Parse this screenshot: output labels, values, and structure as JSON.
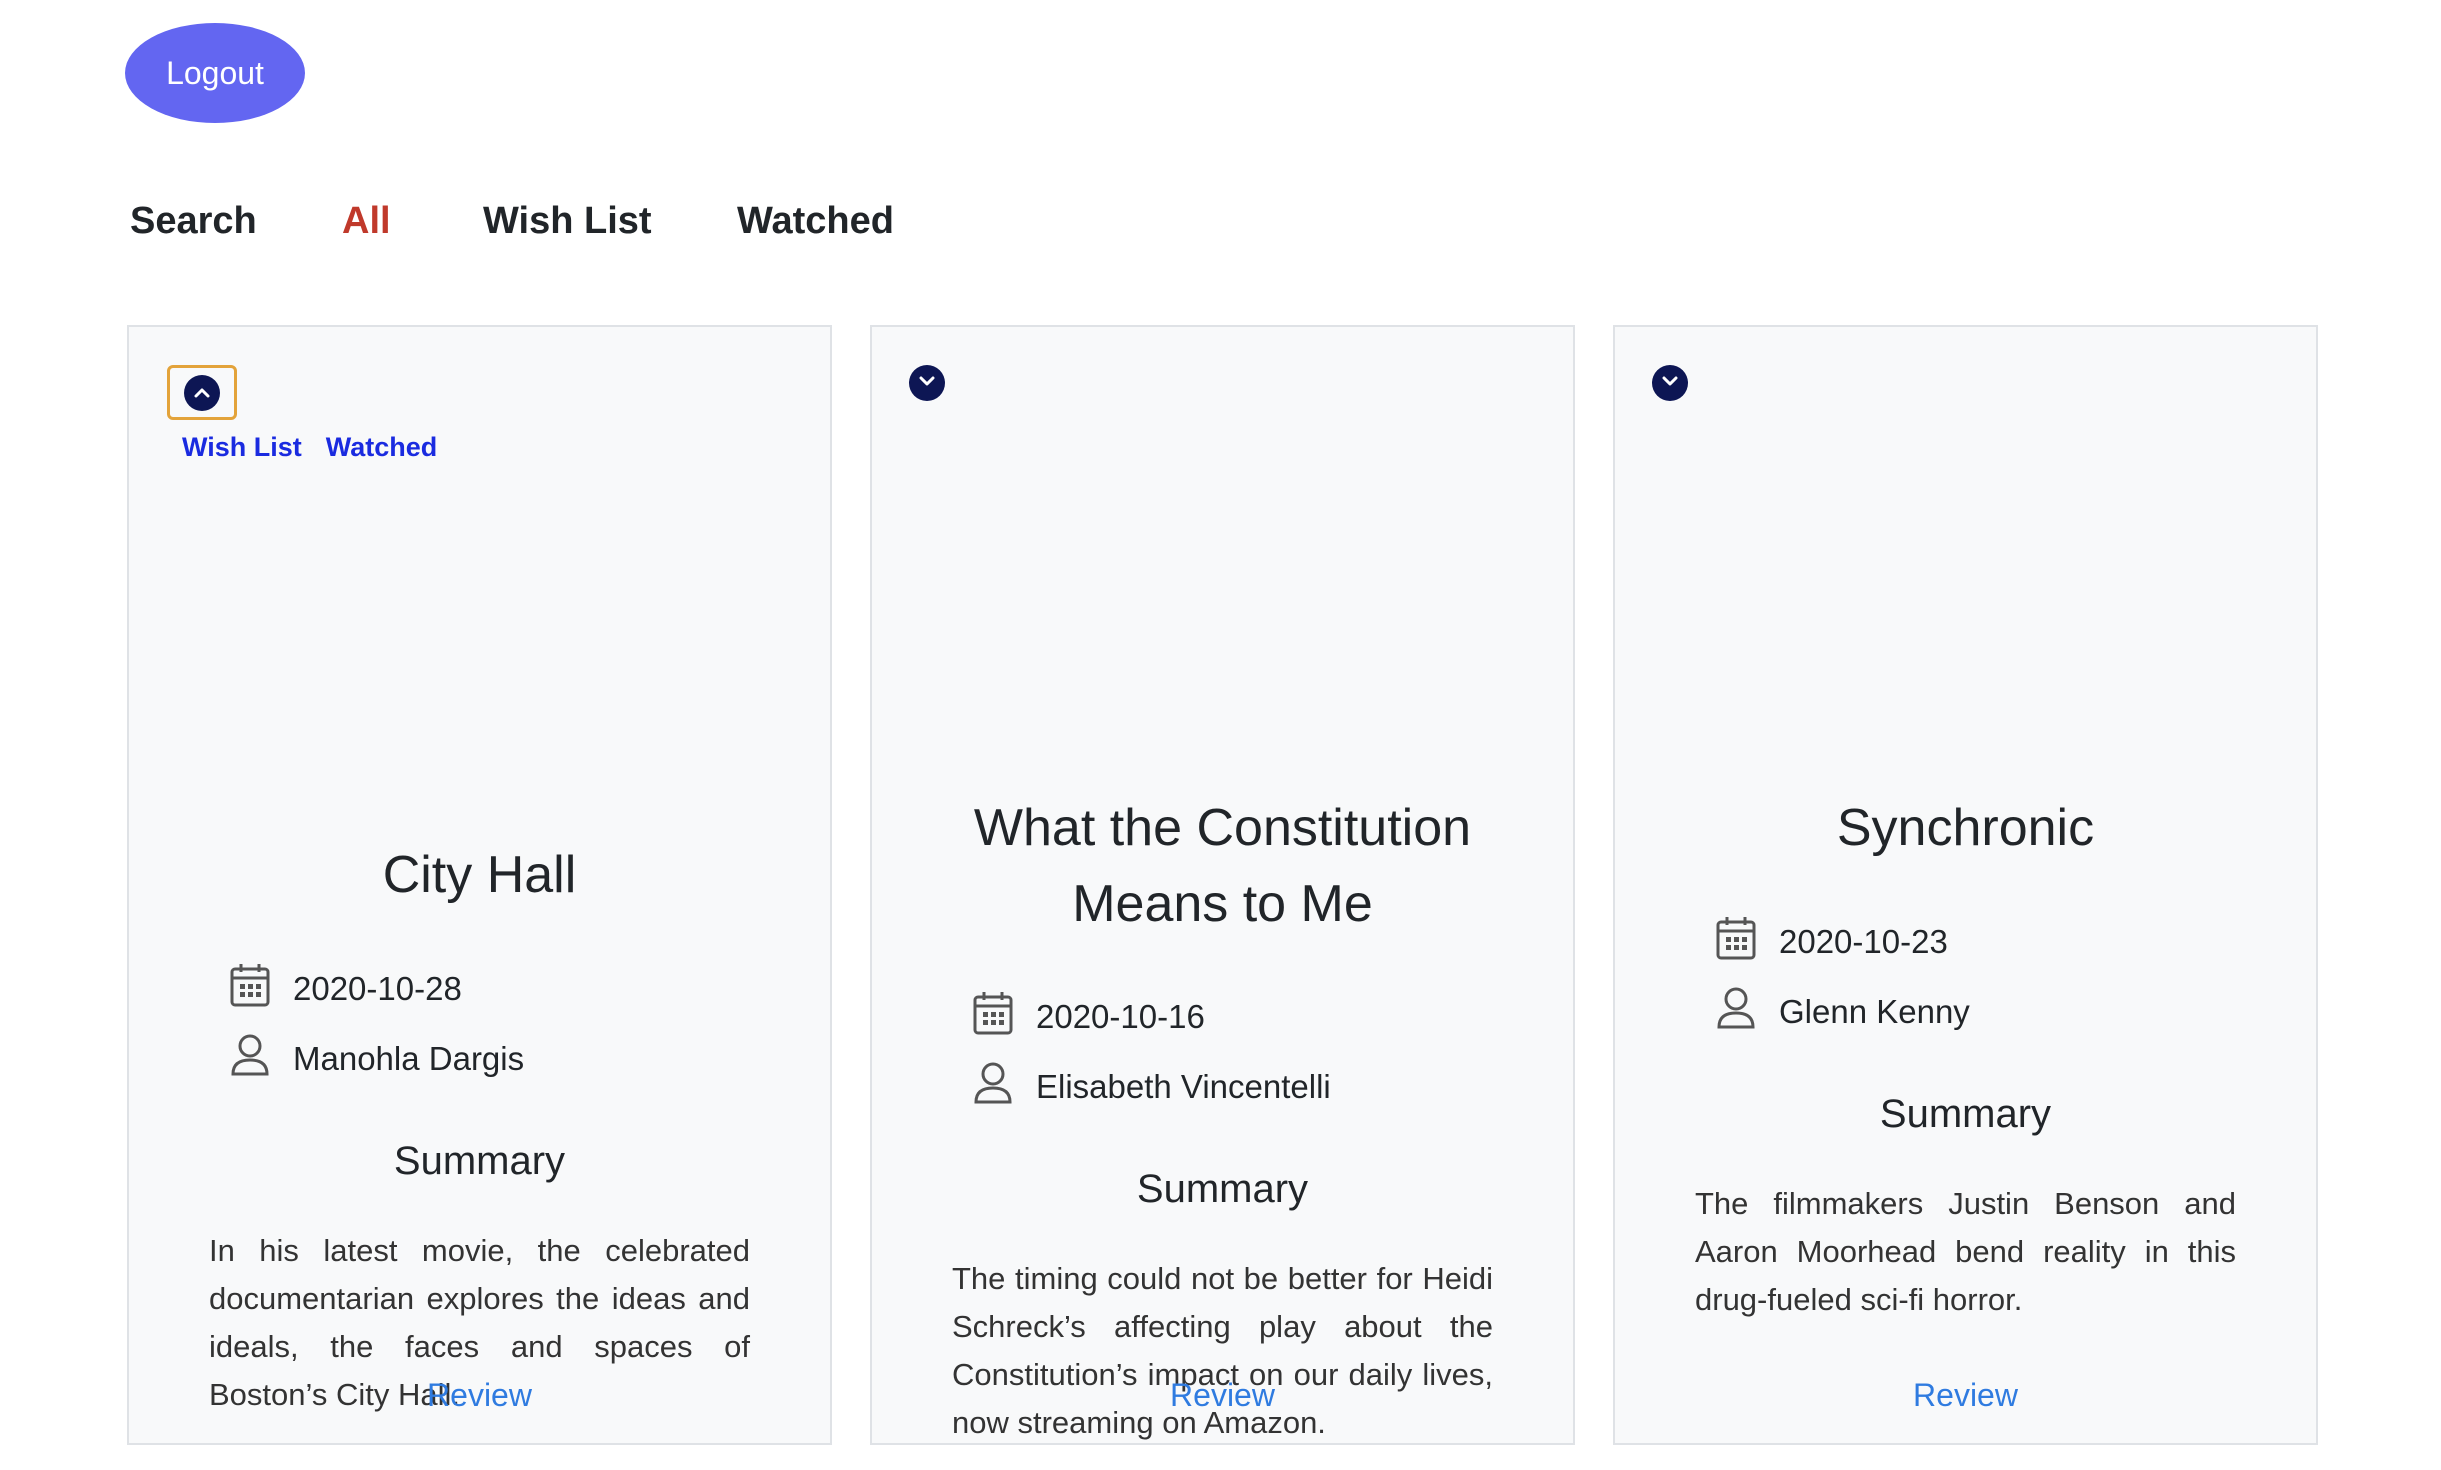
{
  "header": {
    "logout_label": "Logout"
  },
  "nav": {
    "items": [
      {
        "label": "Search"
      },
      {
        "label": "All"
      },
      {
        "label": "Wish List"
      },
      {
        "label": "Watched"
      }
    ],
    "active": "All"
  },
  "cards": [
    {
      "title_lines": [
        "City Hall"
      ],
      "date": "2020-10-28",
      "author": "Manohla Dargis",
      "summary_heading": "Summary",
      "summary": "In his latest movie, the celebrated documentarian explores the ideas and ideals, the faces and spaces of Boston’s City Hall.",
      "review_label": "Review",
      "expanded": true,
      "menu": {
        "wishlist": "Wish List",
        "watched": "Watched"
      }
    },
    {
      "title_lines": [
        "What the Constitution",
        "Means to Me"
      ],
      "date": "2020-10-16",
      "author": "Elisabeth Vincentelli",
      "summary_heading": "Summary",
      "summary": "The timing could not be better for Heidi Schreck’s affecting play about the Constitution’s impact on our daily lives, now streaming on Amazon.",
      "review_label": "Review",
      "expanded": false
    },
    {
      "title_lines": [
        "Synchronic"
      ],
      "date": "2020-10-23",
      "author": "Glenn Kenny",
      "summary_heading": "Summary",
      "summary": "The filmmakers Justin Benson and Aaron Moorhead bend reality in this drug-fueled sci-fi horror.",
      "review_label": "Review",
      "expanded": false
    }
  ],
  "colors": {
    "logout_bg": "#6366f1",
    "active_tab": "#c0392b",
    "link_blue": "#1a2be0",
    "review_blue": "#2f7be0",
    "toggle_navy": "#0d1654",
    "focus_ring": "#e3a33a"
  },
  "icons": [
    "chevron-up-icon",
    "chevron-down-icon",
    "calendar-icon",
    "person-icon"
  ]
}
